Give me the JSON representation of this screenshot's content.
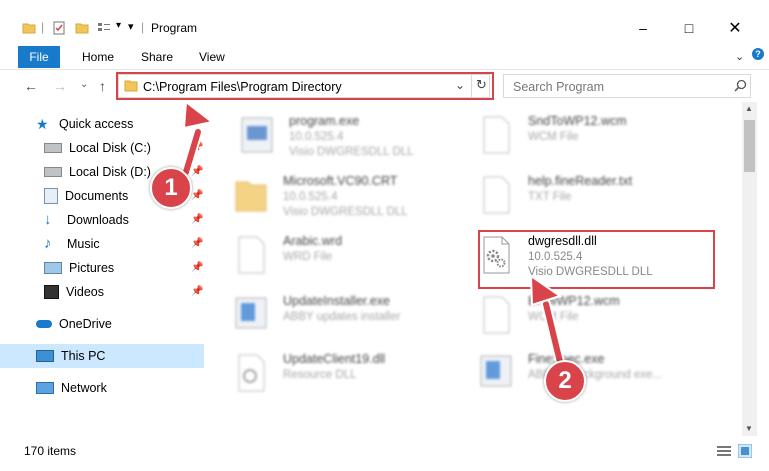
{
  "window": {
    "title": "Program"
  },
  "ribbon": {
    "file": "File",
    "home": "Home",
    "share": "Share",
    "view": "View"
  },
  "address": {
    "path": "C:\\Program Files\\Program Directory"
  },
  "search": {
    "placeholder": "Search Program"
  },
  "sidebar": {
    "quick_access": "Quick access",
    "items": [
      {
        "label": "Local Disk (C:)",
        "pinned": true
      },
      {
        "label": "Local Disk (D:)",
        "pinned": true
      },
      {
        "label": "Documents",
        "pinned": true
      },
      {
        "label": "Downloads",
        "pinned": true
      },
      {
        "label": "Music",
        "pinned": true
      },
      {
        "label": "Pictures",
        "pinned": true
      },
      {
        "label": "Videos",
        "pinned": true
      }
    ],
    "onedrive": "OneDrive",
    "this_pc": "This PC",
    "network": "Network"
  },
  "files": {
    "left": [
      {
        "name": "program.exe",
        "line2": "10.0.525.4",
        "line3": "Visio DWGRESDLL DLL"
      },
      {
        "name": "Microsoft.VC90.CRT",
        "line2": "10.0.525.4",
        "line3": "Visio DWGRESDLL DLL"
      },
      {
        "name": "Arabic.wrd",
        "line2": "WRD File",
        "line3": ""
      },
      {
        "name": "UpdateInstaller.exe",
        "line2": "ABBY updates installer",
        "line3": ""
      },
      {
        "name": "UpdateClient19.dll",
        "line2": "Resource DLL",
        "line3": ""
      }
    ],
    "right": [
      {
        "name": "SndToWP12.wcm",
        "line2": "WCM File",
        "line3": ""
      },
      {
        "name": "help.fineReader.txt",
        "line2": "TXT File",
        "line3": ""
      },
      {
        "name": "dwgresdll.dll",
        "line2": "10.0.525.4",
        "line3": "Visio DWGRESDLL DLL"
      },
      {
        "name": "BrowWP12.wcm",
        "line2": "WCM File",
        "line3": ""
      },
      {
        "name": "FineSpec.exe",
        "line2": "ABBYY Background exe...",
        "line3": ""
      }
    ]
  },
  "status": {
    "count": "170 items"
  },
  "callouts": {
    "one": "1",
    "two": "2"
  },
  "colors": {
    "accent": "#1979ca",
    "highlight": "#d9434a",
    "selection": "#cce8ff"
  }
}
